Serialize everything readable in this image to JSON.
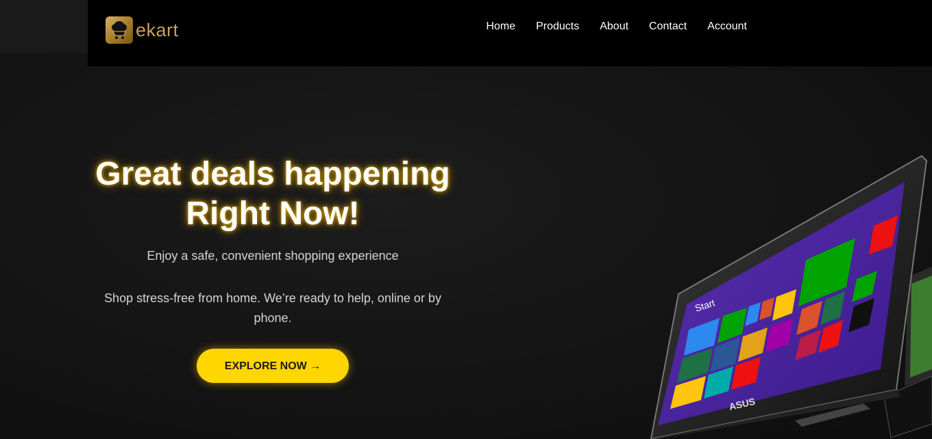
{
  "brand": {
    "name": "ekart",
    "logo_icon": "shopping-cart-icon"
  },
  "nav": {
    "items": [
      {
        "label": "Home"
      },
      {
        "label": "Products"
      },
      {
        "label": "About"
      },
      {
        "label": "Contact"
      },
      {
        "label": "Account"
      }
    ]
  },
  "hero": {
    "title_line1": "Great deals happening",
    "title_line2": "Right Now!",
    "subtitle": "Enjoy a safe, convenient shopping experience",
    "description": "Shop stress-free from home. We’re ready to help, online or by phone.",
    "cta_label": "EXPLORE NOW →",
    "image_alt_icon": "laptop-image"
  },
  "laptop_screen": {
    "start_label": "Start",
    "brand": "ASUS"
  },
  "colors": {
    "accent": "#ffd600",
    "nav_bg": "#000000",
    "page_bg": "#151515",
    "logo_gold": "#c9a05a"
  }
}
